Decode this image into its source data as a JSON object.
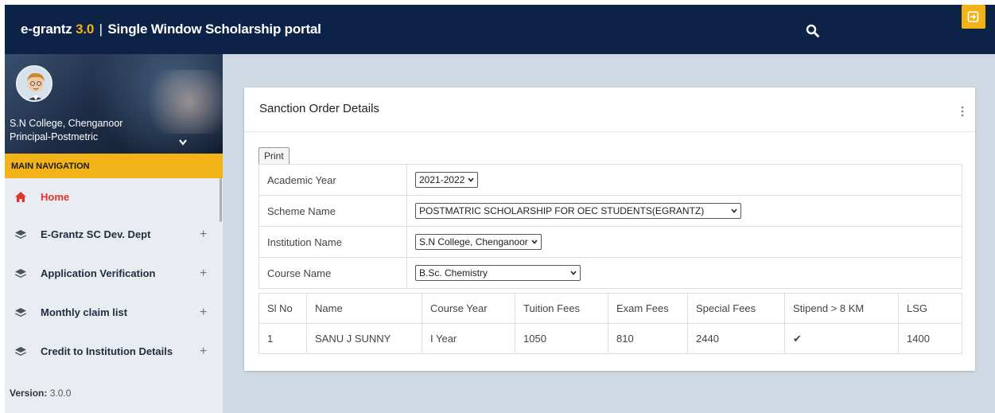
{
  "header": {
    "brand_name": "e-grantz",
    "brand_version": "3.0",
    "brand_separator": "|",
    "brand_tagline": "Single Window Scholarship portal",
    "search_icon": "search-icon",
    "exit_icon": "sign-out-icon",
    "bar_color": "#0d2247",
    "accent_color": "#f2b318"
  },
  "sidebar": {
    "profile": {
      "name": "S.N College, Chenganoor",
      "role": "Principal-Postmetric"
    },
    "nav_header": "MAIN NAVIGATION",
    "items": [
      {
        "label": "Home",
        "icon": "home-icon",
        "active": true
      },
      {
        "label": "E-Grantz SC Dev. Dept",
        "icon": "layers-icon",
        "expand": "+"
      },
      {
        "label": "Application Verification",
        "icon": "layers-icon",
        "expand": "+"
      },
      {
        "label": "Monthly claim list",
        "icon": "layers-icon",
        "expand": "+"
      },
      {
        "label": "Credit to Institution Details",
        "icon": "layers-icon",
        "expand": "+"
      }
    ],
    "version_label": "Version:",
    "version_value": "3.0.0"
  },
  "card": {
    "title": "Sanction Order Details",
    "print_label": "Print",
    "filters": [
      {
        "label": "Academic Year",
        "value": "2021-2022"
      },
      {
        "label": "Scheme Name",
        "value": "POSTMATRIC SCHOLARSHIP FOR OEC STUDENTS(EGRANTZ)"
      },
      {
        "label": "Institution Name",
        "value": "S.N College, Chenganoor"
      },
      {
        "label": "Course Name",
        "value": "B.Sc. Chemistry"
      }
    ],
    "table": {
      "headers": [
        "Sl No",
        "Name",
        "Course Year",
        "Tuition Fees",
        "Exam Fees",
        "Special Fees",
        "Stipend > 8 KM",
        "LSG"
      ],
      "rows": [
        [
          "1",
          "SANU J SUNNY",
          "I Year",
          "1050",
          "810",
          "2440",
          "✔",
          "1400"
        ]
      ]
    }
  }
}
